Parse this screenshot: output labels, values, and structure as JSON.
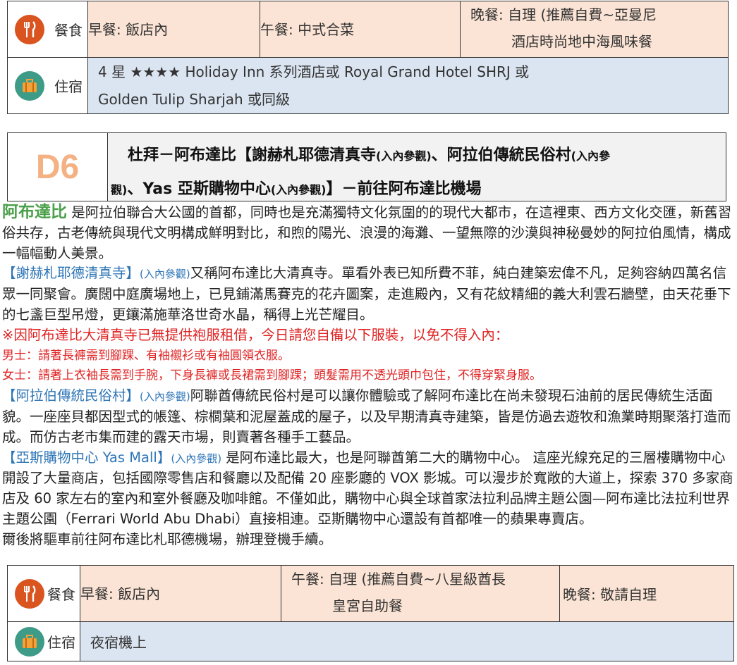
{
  "top_table": {
    "meal_label": "餐食",
    "breakfast": "早餐: 飯店內",
    "lunch": "午餐: 中式合菜",
    "dinner_line1": "晚餐: 自理 (推薦自費~亞曼尼",
    "dinner_line2": "酒店時尚地中海風味餐",
    "hotel_label": "住宿",
    "hotel_line1": "4 星 ★★★★ Holiday Inn 系列酒店或  Royal Grand Hotel SHRJ  或",
    "hotel_line2": "Golden Tulip Sharjah 或同級"
  },
  "day": {
    "number": "D6",
    "title_a": "杜拜－阿布達比【謝赫札耶德清真寺",
    "title_a_note": "(入內參觀)",
    "title_b": "、阿拉伯傳統民俗村",
    "title_b_note": "(入內參",
    "title_c_note": "觀)",
    "title_d": "、Yas 亞斯購物中心",
    "title_d_note": "(入內參觀)",
    "title_e": "】－前往阿布達比機場"
  },
  "content": {
    "intro_name": "阿布達比",
    "intro_text": " 是阿拉伯聯合大公國的首都，同時也是充滿獨特文化氛圍的的現代大都市，在這裡東、西方文化交匯，新舊習俗共存，古老傳統與現代文明構成鮮明對比，和煦的陽光、浪漫的海灘、一望無際的沙漠與神秘曼妙的阿拉伯風情，構成一幅幅動人美景。",
    "mosque_name": "【謝赫札耶德清真寺】",
    "mosque_note": "(入內參觀)",
    "mosque_text": "又稱阿布達比大清真寺。單看外表已知所費不菲，純白建築宏偉不凡，足夠容納四萬名信眾一同聚會。廣闊中庭廣場地上，已見鋪滿馬賽克的花卉圖案，走進殿內，又有花紋精細的義大利雲石牆壁，由天花垂下的七盞巨型吊燈，更鑲滿施華洛世奇水晶，稱得上光芒耀目。",
    "warning": "※因阿布達比大清真寺已無提供袍服租借，今日請您自備以下服裝，以免不得入內：",
    "men": "男士：請著長褲需到腳踝、有袖襯衫或有袖圓領衣服。",
    "women": "女士：請著上衣袖長需到手腕，下身長褲或長裙需到腳踝；頭髮需用不透光頭巾包住，不得穿緊身服。",
    "village_name": "【阿拉伯傳統民俗村】",
    "village_note": "(入內參觀)",
    "village_text": "阿聯酋傳統民俗村是可以讓你體驗或了解阿布達比在尚未發現石油前的居民傳統生活面貌。一座座貝都因型式的帳篷、棕櫚葉和泥屋蓋成的屋子，以及早期清真寺建築，皆是仿過去遊牧和漁業時期聚落打造而成。而仿古老市集而建的露天市場，則賣著各種手工藝品。",
    "mall_name": "【亞斯購物中心 Yas Mall】",
    "mall_note": "(入內參觀)",
    "mall_text": "  是阿布達比最大，也是阿聯酋第二大的購物中心。  這座光線充足的三層樓購物中心開設了大量商店，包括國際零售店和餐廳以及配備 20 座影廳的 VOX  影城。可以漫步於寬敞的大道上，探索 370 多家商店及 60 家左右的室內和室外餐廳及咖啡館。不僅如此，購物中心與全球首家法拉利品牌主題公園—阿布達比法拉利世界主題公園（Ferrari World Abu Dhabi）直接相連。亞斯購物中心還設有首都唯一的蘋果專賣店。",
    "airport": "爾後將驅車前往阿布達比札耶德機場，辦理登機手續。"
  },
  "bottom_table": {
    "meal_label": "餐食",
    "breakfast": "早餐: 飯店內",
    "lunch_line1": "午餐: 自理 (推薦自費~八星級酋長",
    "lunch_line2": "皇宮自助餐",
    "dinner": "晚餐: 敬請自理",
    "hotel_label": "住宿",
    "hotel": "夜宿機上"
  },
  "icons": {
    "meal": "fork-knife-icon",
    "hotel": "suitcase-icon"
  },
  "colors": {
    "meal_icon": "#d9541e",
    "hotel_icon": "#3d9b87",
    "peach_bg": "#fbe4d5",
    "blue_bg": "#dbe5f1",
    "day_number": "#f4b183",
    "green": "#4aa04a",
    "blue_text": "#2e75b6",
    "red_text": "#e02424"
  }
}
